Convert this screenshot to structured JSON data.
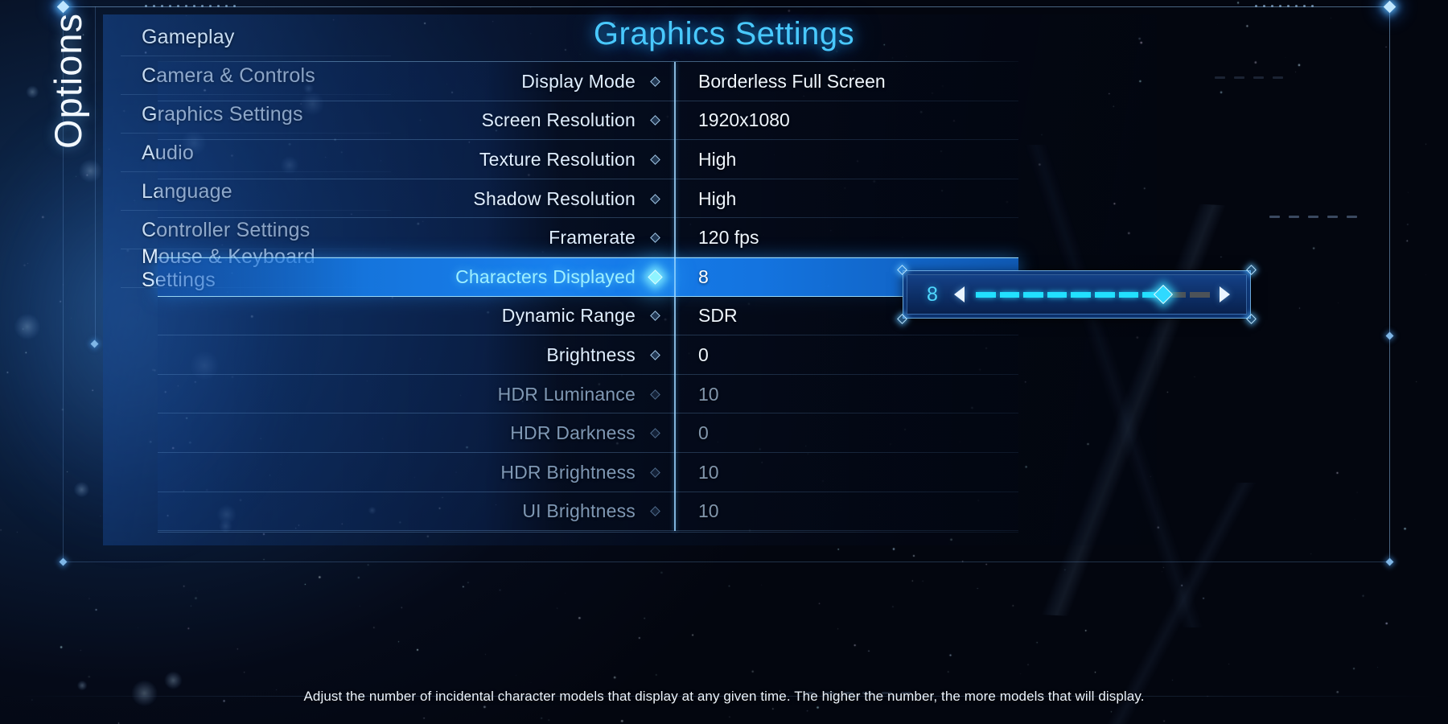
{
  "screen": {
    "vertical_label": "Options",
    "title": "Graphics Settings"
  },
  "sidebar": {
    "items": [
      {
        "label": "Gameplay"
      },
      {
        "label": "Camera & Controls"
      },
      {
        "label": "Graphics Settings"
      },
      {
        "label": "Audio"
      },
      {
        "label": "Language"
      },
      {
        "label": "Controller Settings"
      },
      {
        "label": "Mouse & Keyboard Settings"
      }
    ]
  },
  "settings": {
    "rows": [
      {
        "label": "Display Mode",
        "value": "Borderless Full Screen",
        "state": "normal"
      },
      {
        "label": "Screen Resolution",
        "value": "1920x1080",
        "state": "normal"
      },
      {
        "label": "Texture Resolution",
        "value": "High",
        "state": "normal"
      },
      {
        "label": "Shadow Resolution",
        "value": "High",
        "state": "normal"
      },
      {
        "label": "Framerate",
        "value": "120 fps",
        "state": "normal"
      },
      {
        "label": "Characters Displayed",
        "value": "8",
        "state": "selected"
      },
      {
        "label": "Dynamic Range",
        "value": "SDR",
        "state": "normal"
      },
      {
        "label": "Brightness",
        "value": "0",
        "state": "normal"
      },
      {
        "label": "HDR Luminance",
        "value": "10",
        "state": "disabled"
      },
      {
        "label": "HDR Darkness",
        "value": "0",
        "state": "disabled"
      },
      {
        "label": "HDR Brightness",
        "value": "10",
        "state": "disabled"
      },
      {
        "label": "UI Brightness",
        "value": "10",
        "state": "disabled"
      }
    ]
  },
  "slider_popup": {
    "value": "8",
    "min": 0,
    "max": 10,
    "filled_segments": 8,
    "total_segments": 10,
    "decrease_icon": "triangle-left-icon",
    "increase_icon": "triangle-right-icon"
  },
  "help": {
    "text": "Adjust the number of incidental character models that display at any given time. The higher the number, the more models that will display."
  },
  "colors": {
    "accent_cyan": "#49c9ff",
    "slider_fill": "#22e0ff",
    "slider_empty": "#4c5258",
    "highlight_blue": "#1880ee",
    "text_primary": "#eef5fc",
    "text_dim": "#8296ab"
  }
}
